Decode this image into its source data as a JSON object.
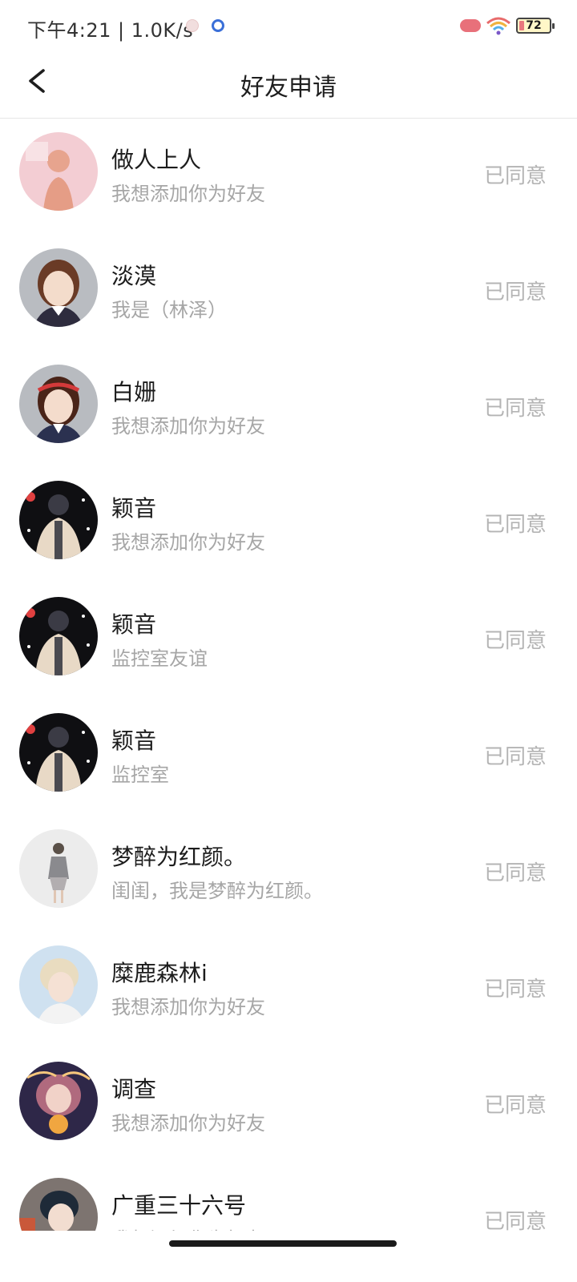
{
  "status_bar": {
    "time_speed": "下午4:21 | 1.0K/s",
    "battery_level": "72"
  },
  "header": {
    "title": "好友申请"
  },
  "requests": [
    {
      "name": "做人上人",
      "message": "我想添加你为好友",
      "status": "已同意"
    },
    {
      "name": "淡漠",
      "message": "我是（林泽）",
      "status": "已同意"
    },
    {
      "name": "白姗",
      "message": "我想添加你为好友",
      "status": "已同意"
    },
    {
      "name": "颖音",
      "message": "我想添加你为好友",
      "status": "已同意"
    },
    {
      "name": "颖音",
      "message": "监控室友谊",
      "status": "已同意"
    },
    {
      "name": "颖音",
      "message": "监控室",
      "status": "已同意"
    },
    {
      "name": "梦醉为红颜。",
      "message": "闺闺，我是梦醉为红颜。",
      "status": "已同意"
    },
    {
      "name": "糜鹿森林i",
      "message": "我想添加你为好友",
      "status": "已同意"
    },
    {
      "name": "调查",
      "message": "我想添加你为好友",
      "status": "已同意"
    },
    {
      "name": "广重三十六号",
      "message": "我想添加你为好友",
      "status": "已同意"
    }
  ],
  "colors": {
    "accent_status": "#b4b4b4",
    "battery_fill": "#fff7c8"
  }
}
